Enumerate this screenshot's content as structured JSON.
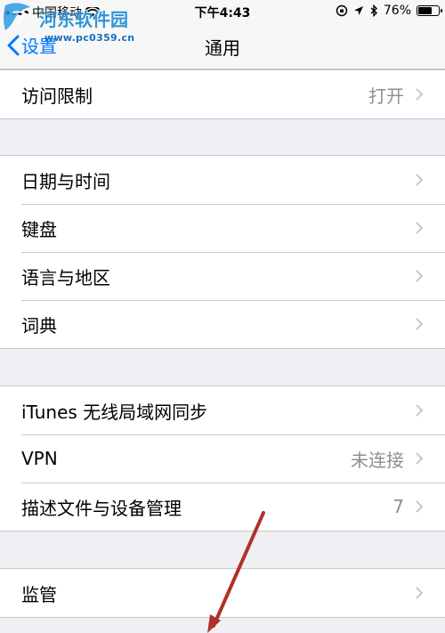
{
  "status_bar": {
    "carrier": "中国移动",
    "time": "下午4:43",
    "battery_percent": "76%",
    "battery_level": 0.76
  },
  "watermark": {
    "name": "河东软件园",
    "url": "www.pc0359.cn"
  },
  "nav": {
    "back_label": "设置",
    "title": "通用"
  },
  "groups": [
    {
      "rows": [
        {
          "label": "访问限制",
          "value": "打开"
        }
      ]
    },
    {
      "rows": [
        {
          "label": "日期与时间",
          "value": ""
        },
        {
          "label": "键盘",
          "value": ""
        },
        {
          "label": "语言与地区",
          "value": ""
        },
        {
          "label": "词典",
          "value": ""
        }
      ]
    },
    {
      "rows": [
        {
          "label": "iTunes 无线局域网同步",
          "value": ""
        },
        {
          "label": "VPN",
          "value": "未连接"
        },
        {
          "label": "描述文件与设备管理",
          "value": "7"
        }
      ]
    },
    {
      "rows": [
        {
          "label": "监管",
          "value": ""
        }
      ]
    }
  ],
  "colors": {
    "accent": "#007aff",
    "background": "#efeff4",
    "separator": "#c8c7cc",
    "secondary_text": "#8e8e93",
    "annotation_arrow": "#b0302a"
  }
}
